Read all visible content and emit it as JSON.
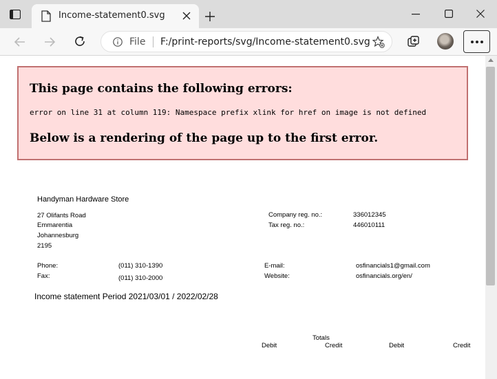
{
  "browser": {
    "tab_title": "Income-statement0.svg",
    "address_scheme": "File",
    "address_url": "F:/print-reports/svg/Income-statement0.svg"
  },
  "error_box": {
    "heading": "This page contains the following errors:",
    "message": "error on line 31 at column 119: Namespace prefix xlink for href on image is not defined",
    "footer": "Below is a rendering of the page up to the first error."
  },
  "company": {
    "name": "Handyman Hardware Store",
    "address": [
      "27 Olifants Road",
      "Emmarentia",
      "Johannesburg",
      "2195"
    ],
    "reg_label": "Company reg. no.:",
    "reg_value": "336012345",
    "tax_label": "Tax reg. no.:",
    "tax_value": "446010111",
    "phone_label": "Phone:",
    "phone_value": "(011) 310-1390",
    "fax_label": "Fax:",
    "fax_value": "(011) 310-2000",
    "email_label": "E-mail:",
    "email_value": "osfinancials1@gmail.com",
    "website_label": "Website:",
    "website_value": "osfinancials.org/en/"
  },
  "report": {
    "title": "Income statement Period 2021/03/01 / 2022/02/28",
    "totals_label": "Totals",
    "columns": [
      "Debit",
      "Credit",
      "Debit",
      "Credit"
    ]
  }
}
